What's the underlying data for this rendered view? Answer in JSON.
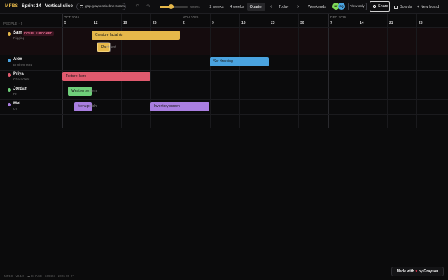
{
  "app": {
    "logo": "MFBS",
    "title": "Sprint 14 · Vertical slice",
    "share_link": "gsp.graysonchelmers.com",
    "zoom_label": "Weeks",
    "zoom_level_fraction": 0.4,
    "range_options": [
      "2 weeks",
      "4 weeks",
      "Quarter"
    ],
    "range_selected": "Quarter",
    "today_label": "Today",
    "weekends_label": "Weekends",
    "prev_icon": "chevron-left-icon",
    "next_icon": "chevron-right-icon",
    "avatars": [
      {
        "initials": "BP",
        "color": "#7ed957"
      },
      {
        "initials": "SQ",
        "color": "#4aa3df"
      }
    ],
    "view_only_label": "View only",
    "share_label": "Share",
    "boards_label": "Boards",
    "new_board_label": "+ New board"
  },
  "timeline": {
    "people_header": "PEOPLE · 5",
    "months": [
      {
        "label": "OCT 2026"
      },
      {
        "label": "NOV 2026"
      },
      {
        "label": "DEC 2026"
      }
    ],
    "weeks": [
      "5",
      "12",
      "19",
      "26",
      "2",
      "9",
      "16",
      "23",
      "30",
      "7",
      "14",
      "21",
      "28"
    ]
  },
  "people": [
    {
      "name": "Sam",
      "role": "Rigging",
      "color": "#e6b84a",
      "badge": "DOUBLE-BOOKED"
    },
    {
      "name": "Alex",
      "role": "Environment",
      "color": "#4aa3df"
    },
    {
      "name": "Priya",
      "role": "Characters",
      "color": "#e05a6e"
    },
    {
      "name": "Jordan",
      "role": "FX",
      "color": "#6fcf7a"
    },
    {
      "name": "Mei",
      "role": "UI",
      "color": "#a97ee0"
    }
  ],
  "tasks": [
    {
      "label": "Creature facial rig",
      "person": "Sam",
      "color": "#e6b84a"
    },
    {
      "label": "Pa",
      "overflow": "int fest",
      "person": "Sam",
      "color": "#e6b84a"
    },
    {
      "label": "Set dressing",
      "person": "Alex",
      "color": "#4aa3df"
    },
    {
      "label": "Texture: hero",
      "person": "Priya",
      "color": "#e05a6e"
    },
    {
      "label": "Weather sy",
      "overflow": "stem",
      "person": "Jordan",
      "color": "#6fcf7a"
    },
    {
      "label": "Menu p",
      "overflow": "olish",
      "person": "Mei",
      "color": "#a97ee0"
    },
    {
      "label": "Inventory screen",
      "person": "Mei",
      "color": "#a97ee0"
    }
  ],
  "footer": {
    "version": "MFBS · v0.1.0 · ☁ CHASE · b0942c · 2026-09-27",
    "made_with_prefix": "Made with",
    "made_with_suffix": "by Grayson"
  }
}
